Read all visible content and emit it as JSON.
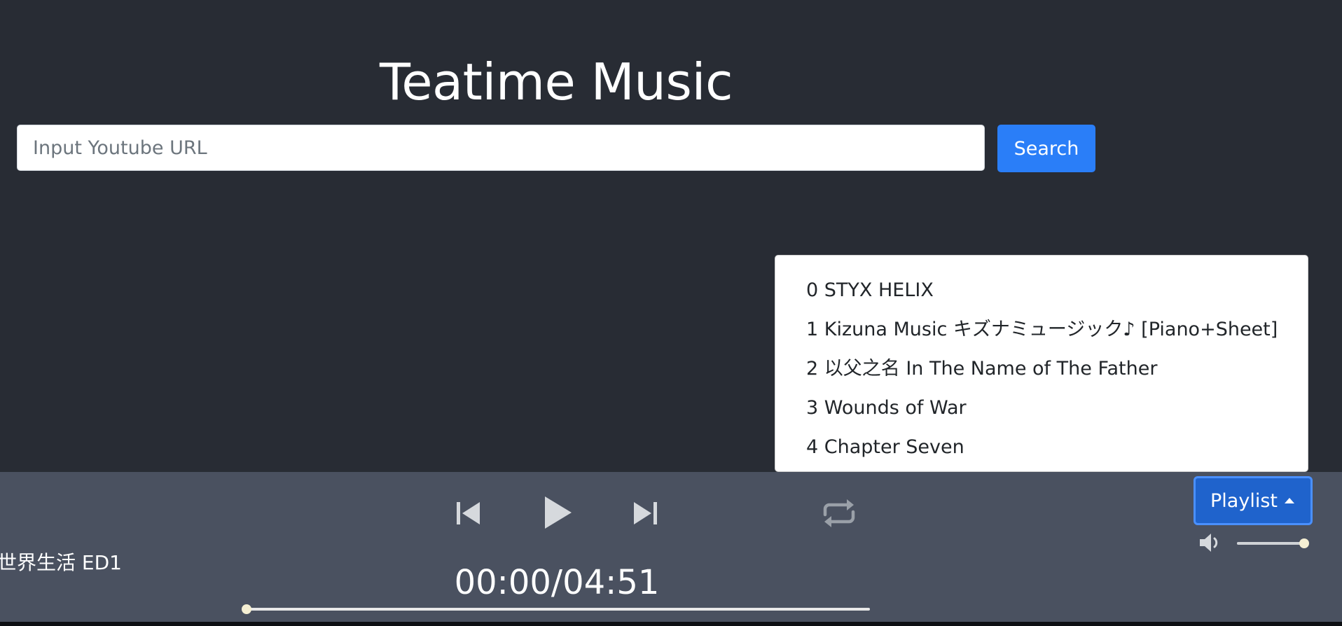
{
  "app": {
    "title": "Teatime Music"
  },
  "search": {
    "placeholder": "Input Youtube URL",
    "value": "",
    "button_label": "Search"
  },
  "playlist": {
    "button_label": "Playlist",
    "items": [
      {
        "label": "0 STYX HELIX"
      },
      {
        "label": "1 Kizuna Music キズナミュージック♪ [Piano+Sheet]"
      },
      {
        "label": "2 以父之名 In The Name of The Father"
      },
      {
        "label": "3 Wounds of War"
      },
      {
        "label": "4 Chapter Seven"
      }
    ]
  },
  "player": {
    "now_playing": "世界生活 ED1",
    "time_display": "00:00/04:51",
    "progress_fraction": 0,
    "volume_fraction": 1,
    "icons": {
      "previous": "skip-previous-icon",
      "play": "play-icon",
      "next": "skip-next-icon",
      "repeat": "repeat-icon",
      "volume": "volume-icon",
      "caret": "caret-up-icon"
    }
  },
  "colors": {
    "background": "#282c34",
    "player_bar": "#4a5160",
    "accent": "#2a7ef8",
    "playlist_button": "#1f63cc",
    "thumb": "#f5efd3"
  }
}
